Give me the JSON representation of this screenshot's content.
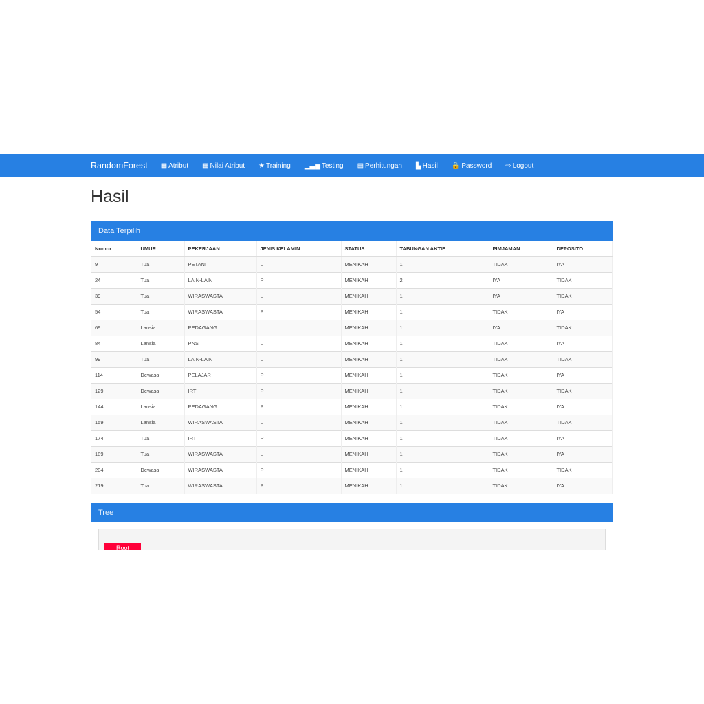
{
  "navbar": {
    "brand": "RandomForest",
    "items": [
      {
        "label": "Atribut",
        "icon": "th-large-icon",
        "glyph": "▦"
      },
      {
        "label": "Nilai Atribut",
        "icon": "th-icon",
        "glyph": "▦"
      },
      {
        "label": "Training",
        "icon": "star-icon",
        "glyph": "★"
      },
      {
        "label": "Testing",
        "icon": "signal-icon",
        "glyph": "▁▃▅"
      },
      {
        "label": "Perhitungan",
        "icon": "calendar-icon",
        "glyph": "▤"
      },
      {
        "label": "Hasil",
        "icon": "stats-icon",
        "glyph": "▙"
      },
      {
        "label": "Password",
        "icon": "lock-icon",
        "glyph": "🔒"
      },
      {
        "label": "Logout",
        "icon": "log-out-icon",
        "glyph": "⇨"
      }
    ]
  },
  "page_title": "Hasil",
  "data_panel": {
    "title": "Data Terpilih",
    "columns": [
      "Nomor",
      "UMUR",
      "PEKERJAAN",
      "JENIS KELAMIN",
      "STATUS",
      "TABUNGAN AKTIF",
      "PIMJAMAN",
      "DEPOSITO"
    ],
    "rows": [
      [
        "9",
        "Tua",
        "PETANI",
        "L",
        "MENIKAH",
        "1",
        "TIDAK",
        "IYA"
      ],
      [
        "24",
        "Tua",
        "LAIN-LAIN",
        "P",
        "MENIKAH",
        "2",
        "IYA",
        "TIDAK"
      ],
      [
        "39",
        "Tua",
        "WIRASWASTA",
        "L",
        "MENIKAH",
        "1",
        "IYA",
        "TIDAK"
      ],
      [
        "54",
        "Tua",
        "WIRASWASTA",
        "P",
        "MENIKAH",
        "1",
        "TIDAK",
        "IYA"
      ],
      [
        "69",
        "Lansia",
        "PEDAGANG",
        "L",
        "MENIKAH",
        "1",
        "IYA",
        "TIDAK"
      ],
      [
        "84",
        "Lansia",
        "PNS",
        "L",
        "MENIKAH",
        "1",
        "TIDAK",
        "IYA"
      ],
      [
        "99",
        "Tua",
        "LAIN-LAIN",
        "L",
        "MENIKAH",
        "1",
        "TIDAK",
        "TIDAK"
      ],
      [
        "114",
        "Dewasa",
        "PELAJAR",
        "P",
        "MENIKAH",
        "1",
        "TIDAK",
        "IYA"
      ],
      [
        "129",
        "Dewasa",
        "IRT",
        "P",
        "MENIKAH",
        "1",
        "TIDAK",
        "TIDAK"
      ],
      [
        "144",
        "Lansia",
        "PEDAGANG",
        "P",
        "MENIKAH",
        "1",
        "TIDAK",
        "IYA"
      ],
      [
        "159",
        "Lansia",
        "WIRASWASTA",
        "L",
        "MENIKAH",
        "1",
        "TIDAK",
        "TIDAK"
      ],
      [
        "174",
        "Tua",
        "IRT",
        "P",
        "MENIKAH",
        "1",
        "TIDAK",
        "IYA"
      ],
      [
        "189",
        "Tua",
        "WIRASWASTA",
        "L",
        "MENIKAH",
        "1",
        "TIDAK",
        "IYA"
      ],
      [
        "204",
        "Dewasa",
        "WIRASWASTA",
        "P",
        "MENIKAH",
        "1",
        "TIDAK",
        "TIDAK"
      ],
      [
        "219",
        "Tua",
        "WIRASWASTA",
        "P",
        "MENIKAH",
        "1",
        "TIDAK",
        "IYA"
      ]
    ]
  },
  "tree_panel": {
    "title": "Tree",
    "root_label": "Root"
  }
}
